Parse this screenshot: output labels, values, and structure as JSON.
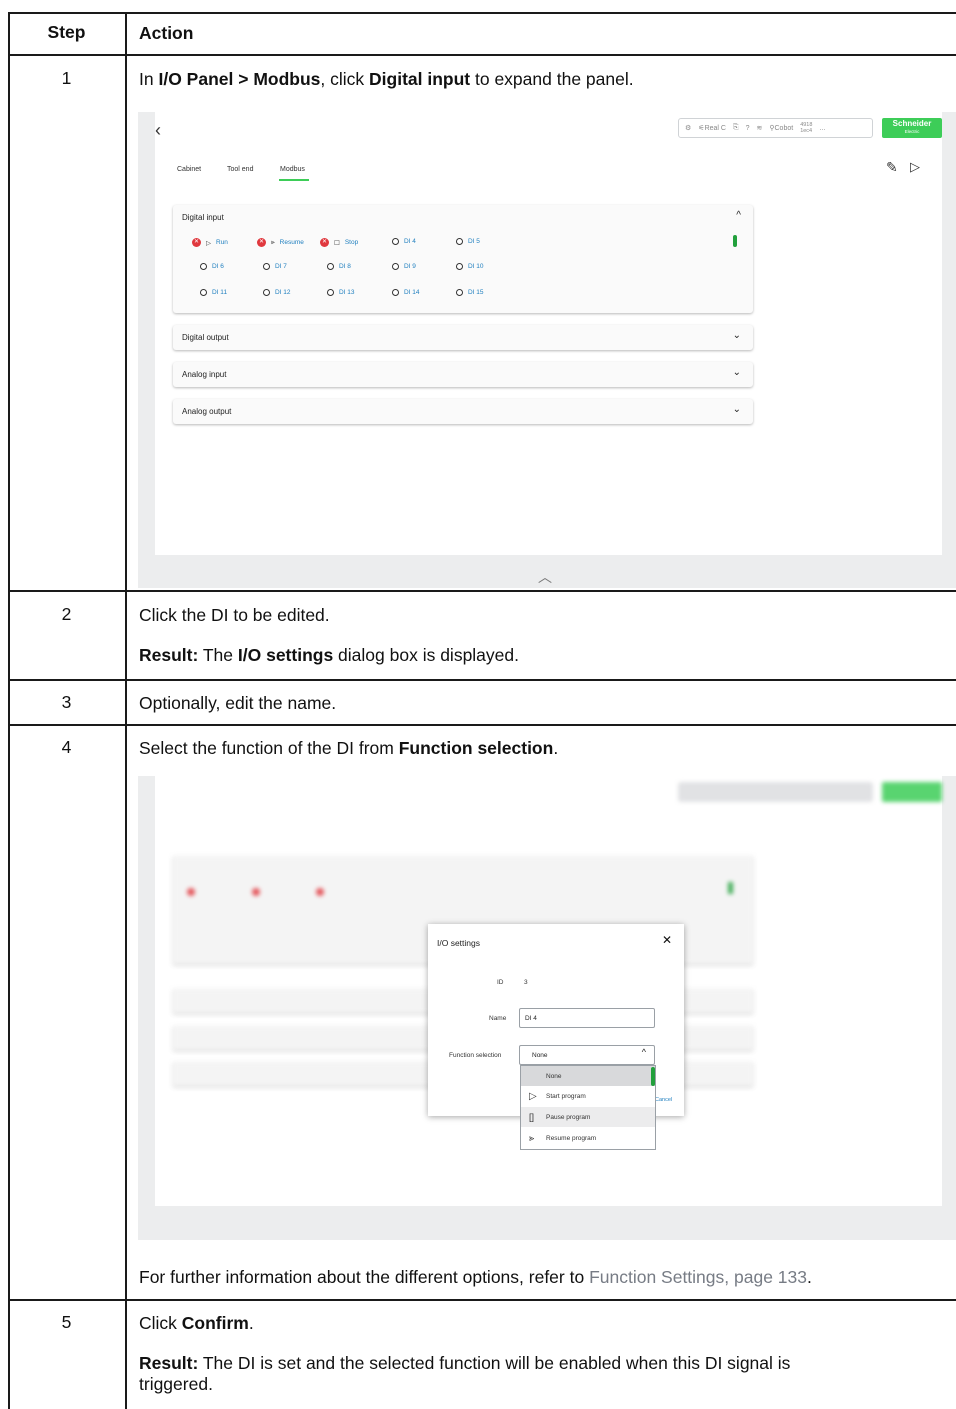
{
  "table": {
    "headers": {
      "step": "Step",
      "action": "Action"
    }
  },
  "rows": [
    {
      "step": "1",
      "text_a": "In ",
      "b1": "I/O Panel",
      "sep": " > ",
      "b2": "Modbus",
      "text_b": ", click ",
      "b3": "Digital input",
      "text_c": " to expand the panel."
    },
    {
      "step": "2",
      "line1": "Click the DI to be edited.",
      "result_label": "Result:",
      "result_a": " The ",
      "result_b": "I/O settings",
      "result_c": " dialog box is displayed."
    },
    {
      "step": "3",
      "line1": "Optionally, edit the name."
    },
    {
      "step": "4",
      "text_a": "Select the function of the DI from ",
      "b1": "Function selection",
      "text_b": ".",
      "footer_a": "For further information about the different options, refer to ",
      "footer_link": "Function Settings, page 133",
      "footer_b": "."
    },
    {
      "step": "5",
      "text_a": "Click ",
      "b1": "Confirm",
      "text_b": ".",
      "result_label": "Result:",
      "result_line1": " The DI is set and the selected function will be enabled when this DI signal is",
      "result_line2": "triggered."
    }
  ],
  "screenshot1": {
    "back_icon": "chevron-left-icon",
    "status": {
      "robot_state": "Real C",
      "help": "?",
      "cobot": "Cobot",
      "counter_top": "4918",
      "counter_bottom": "1ec4",
      "more": "..."
    },
    "brand": {
      "name": "Schneider",
      "sub": "Electric",
      "color": "#3dcd58"
    },
    "tabs": [
      "Cabinet",
      "Tool end",
      "Modbus"
    ],
    "active_tab": "Modbus",
    "panels": {
      "digital_input": "Digital input",
      "digital_output": "Digital output",
      "analog_input": "Analog input",
      "analog_output": "Analog output"
    },
    "di_items": {
      "run": "Run",
      "resume": "Resume",
      "stop": "Stop",
      "di4": "DI 4",
      "di5": "DI 5",
      "di6": "DI 6",
      "di7": "DI 7",
      "di8": "DI 8",
      "di9": "DI 9",
      "di10": "DI 10",
      "di11": "DI 11",
      "di12": "DI 12",
      "di13": "DI 13",
      "di14": "DI 14",
      "di15": "DI 15"
    }
  },
  "screenshot2": {
    "dialog": {
      "title": "I/O settings",
      "id_label": "ID",
      "id_value": "3",
      "name_label": "Name",
      "name_value": "DI 4",
      "function_label": "Function selection",
      "function_value": "None",
      "cancel": "Cancel"
    },
    "options": [
      "None",
      "Start program",
      "Pause program",
      "Resume program"
    ],
    "selected_option": "None"
  }
}
